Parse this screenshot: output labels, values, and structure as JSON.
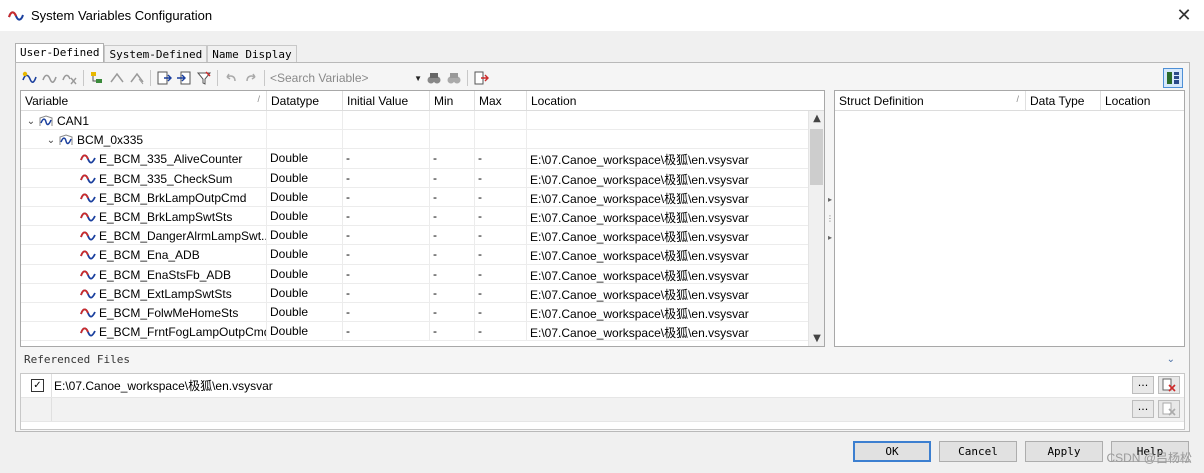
{
  "window": {
    "title": "System Variables Configuration",
    "close_glyph": "✕"
  },
  "tabs": [
    {
      "label": "User-Defined"
    },
    {
      "label": "System-Defined"
    },
    {
      "label": "Name Display"
    }
  ],
  "toolbar": {
    "search_placeholder": "<Search Variable>"
  },
  "grid": {
    "columns": [
      "Variable",
      "Datatype",
      "Initial Value",
      "Min",
      "Max",
      "Location"
    ],
    "tree": [
      {
        "name": "CAN1",
        "level": 0,
        "expanded": true
      },
      {
        "name": "BCM_0x335",
        "level": 1,
        "expanded": true
      }
    ],
    "rows": [
      {
        "variable": "E_BCM_335_AliveCounter",
        "datatype": "Double",
        "initial": "-",
        "min": "-",
        "max": "-",
        "location": "E:\\07.Canoe_workspace\\极狐\\en.vsysvar"
      },
      {
        "variable": "E_BCM_335_CheckSum",
        "datatype": "Double",
        "initial": "-",
        "min": "-",
        "max": "-",
        "location": "E:\\07.Canoe_workspace\\极狐\\en.vsysvar"
      },
      {
        "variable": "E_BCM_BrkLampOutpCmd",
        "datatype": "Double",
        "initial": "-",
        "min": "-",
        "max": "-",
        "location": "E:\\07.Canoe_workspace\\极狐\\en.vsysvar"
      },
      {
        "variable": "E_BCM_BrkLampSwtSts",
        "datatype": "Double",
        "initial": "-",
        "min": "-",
        "max": "-",
        "location": "E:\\07.Canoe_workspace\\极狐\\en.vsysvar"
      },
      {
        "variable": "E_BCM_DangerAlrmLampSwt...",
        "datatype": "Double",
        "initial": "-",
        "min": "-",
        "max": "-",
        "location": "E:\\07.Canoe_workspace\\极狐\\en.vsysvar"
      },
      {
        "variable": "E_BCM_Ena_ADB",
        "datatype": "Double",
        "initial": "-",
        "min": "-",
        "max": "-",
        "location": "E:\\07.Canoe_workspace\\极狐\\en.vsysvar"
      },
      {
        "variable": "E_BCM_EnaStsFb_ADB",
        "datatype": "Double",
        "initial": "-",
        "min": "-",
        "max": "-",
        "location": "E:\\07.Canoe_workspace\\极狐\\en.vsysvar"
      },
      {
        "variable": "E_BCM_ExtLampSwtSts",
        "datatype": "Double",
        "initial": "-",
        "min": "-",
        "max": "-",
        "location": "E:\\07.Canoe_workspace\\极狐\\en.vsysvar"
      },
      {
        "variable": "E_BCM_FolwMeHomeSts",
        "datatype": "Double",
        "initial": "-",
        "min": "-",
        "max": "-",
        "location": "E:\\07.Canoe_workspace\\极狐\\en.vsysvar"
      },
      {
        "variable": "E_BCM_FrntFogLampOutpCmd",
        "datatype": "Double",
        "initial": "-",
        "min": "-",
        "max": "-",
        "location": "E:\\07.Canoe_workspace\\极狐\\en.vsysvar"
      }
    ]
  },
  "struct_grid": {
    "columns": [
      "Struct Definition",
      "Data Type",
      "Location"
    ]
  },
  "referenced_files": {
    "label": "Referenced Files",
    "files": [
      {
        "checked": true,
        "path": "E:\\07.Canoe_workspace\\极狐\\en.vsysvar"
      }
    ],
    "ellipsis": "..."
  },
  "buttons": {
    "ok": "OK",
    "cancel": "Cancel",
    "apply": "Apply",
    "help": "Help"
  },
  "watermark": "CSDN @吕杨松",
  "colors": {
    "accent": "#3c7fd0",
    "variable_icon": "#1a3f9e",
    "variable_icon_red": "#cc2a2a"
  }
}
